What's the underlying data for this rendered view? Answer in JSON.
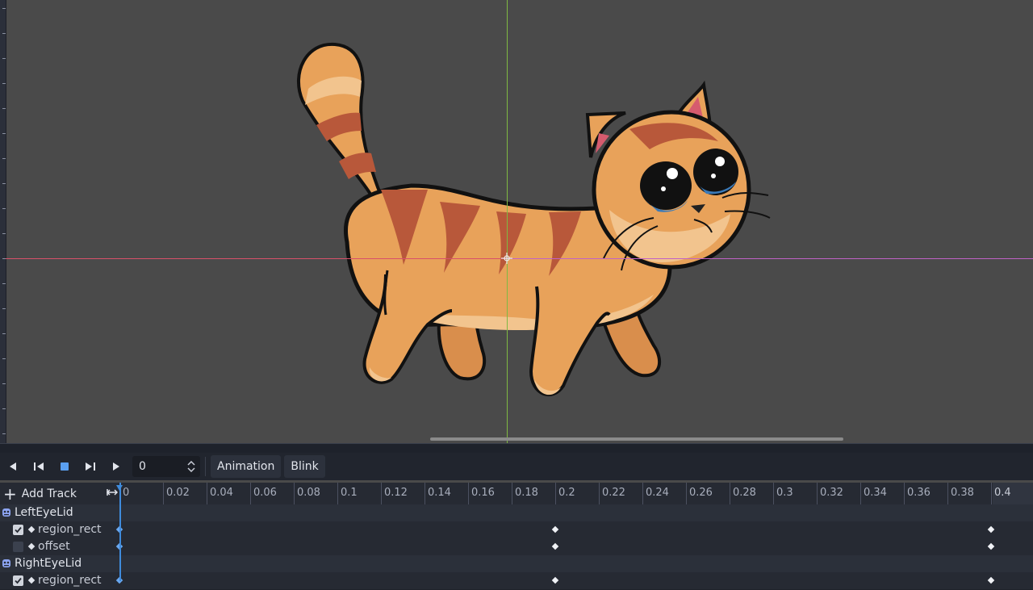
{
  "colors": {
    "viewport_bg": "#4a4a4a",
    "axis_x": "#d8506a",
    "axis_y": "#7fb843",
    "playhead": "#3f8bdc",
    "panel_bg": "#262a33",
    "cat_fur": "#e8a25a",
    "cat_stripe": "#b8583a",
    "cat_outline": "#111111"
  },
  "icons": {
    "play_backwards": "play-backwards-icon",
    "step_back": "step-back-icon",
    "stop": "stop-icon",
    "step_forward": "step-forward-icon",
    "play": "play-icon",
    "spin_arrows": "spin-arrows-icon",
    "add": "plus-icon",
    "snap": "horizontal-arrows-icon",
    "node": "sprite-node-icon"
  },
  "toolbar": {
    "time_value": "0",
    "animation_menu": "Animation",
    "current_animation": "Blink"
  },
  "track_editor": {
    "add_track_label": "Add Track",
    "ruler_labels": [
      "0",
      "0.02",
      "0.04",
      "0.06",
      "0.08",
      "0.1",
      "0.12",
      "0.14",
      "0.16",
      "0.18",
      "0.2",
      "0.22",
      "0.24",
      "0.26",
      "0.28",
      "0.3",
      "0.32",
      "0.34",
      "0.36",
      "0.38",
      "0.4"
    ],
    "length": 0.4,
    "groups": [
      {
        "name": "LeftEyeLid",
        "tracks": [
          {
            "property": "region_rect",
            "enabled": true,
            "keys": [
              0,
              0.2,
              0.4
            ]
          },
          {
            "property": "offset",
            "enabled": false,
            "keys": [
              0,
              0.2,
              0.4
            ]
          }
        ]
      },
      {
        "name": "RightEyeLid",
        "tracks": [
          {
            "property": "region_rect",
            "enabled": true,
            "keys": [
              0,
              0.2,
              0.4
            ]
          }
        ]
      }
    ]
  }
}
